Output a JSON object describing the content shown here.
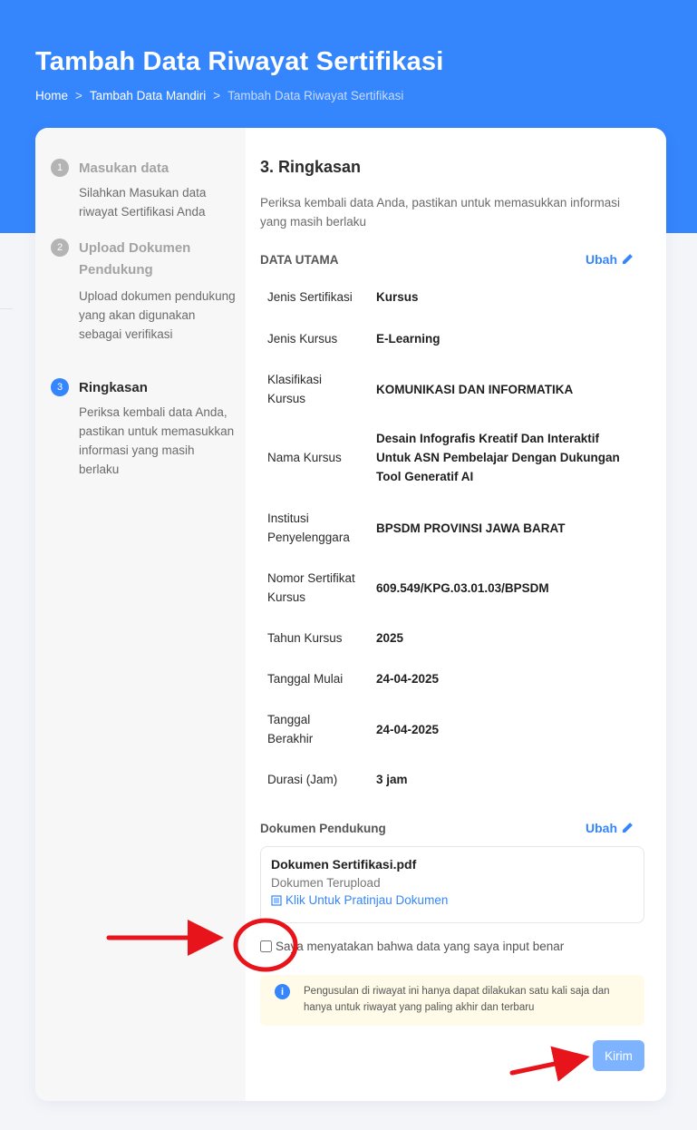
{
  "header": {
    "title": "Tambah Data Riwayat Sertifikasi",
    "breadcrumb": [
      "Home",
      "Tambah Data Mandiri",
      "Tambah Data Riwayat Sertifikasi"
    ],
    "separator": ">"
  },
  "steps": [
    {
      "number": "1",
      "title": "Masukan data",
      "desc": "Silahkan Masukan data riwayat Sertifikasi Anda"
    },
    {
      "number": "2",
      "title": "Upload Dokumen Pendukung",
      "desc": "Upload dokumen pendukung yang akan digunakan sebagai verifikasi"
    },
    {
      "number": "3",
      "title": "Ringkasan",
      "desc": "Periksa kembali data Anda, pastikan untuk memasukkan informasi yang masih berlaku"
    }
  ],
  "summary": {
    "title": "3. Ringkasan",
    "desc": "Periksa kembali data Anda, pastikan untuk memasukkan informasi yang masih berlaku",
    "data_utama_label": "DATA UTAMA",
    "edit_label": "Ubah",
    "rows": [
      {
        "label": "Jenis Sertifikasi",
        "value": "Kursus"
      },
      {
        "label": "Jenis Kursus",
        "value": "E-Learning"
      },
      {
        "label": "Klasifikasi Kursus",
        "value": "KOMUNIKASI DAN INFORMATIKA"
      },
      {
        "label": "Nama Kursus",
        "value": "Desain Infografis Kreatif Dan Interaktif Untuk ASN Pembelajar Dengan Dukungan Tool Generatif AI"
      },
      {
        "label": "Institusi Penyelenggara",
        "value": "BPSDM PROVINSI JAWA BARAT"
      },
      {
        "label": "Nomor Sertifikat Kursus",
        "value": "609.549/KPG.03.01.03/BPSDM"
      },
      {
        "label": "Tahun Kursus",
        "value": "2025"
      },
      {
        "label": "Tanggal Mulai",
        "value": "24-04-2025"
      },
      {
        "label": "Tanggal Berakhir",
        "value": "24-04-2025"
      },
      {
        "label": "Durasi (Jam)",
        "value": "3 jam"
      }
    ]
  },
  "documents": {
    "label": "Dokumen Pendukung",
    "edit_label": "Ubah",
    "file_name": "Dokumen Sertifikasi.pdf",
    "status": "Dokumen Terupload",
    "preview_link": "Klik Untuk Pratinjau Dokumen"
  },
  "agreement": {
    "label": "Saya menyatakan bahwa data yang saya input benar",
    "checked": false
  },
  "notice": {
    "text": "Pengusulan di riwayat ini hanya dapat dilakukan satu kali saja dan hanya untuk riwayat yang paling akhir dan terbaru"
  },
  "submit_label": "Kirim",
  "colors": {
    "primary": "#3585fc",
    "submit_disabled": "#7eb3ff",
    "notice_bg": "#fffbe8",
    "annotation": "#e8141b"
  }
}
